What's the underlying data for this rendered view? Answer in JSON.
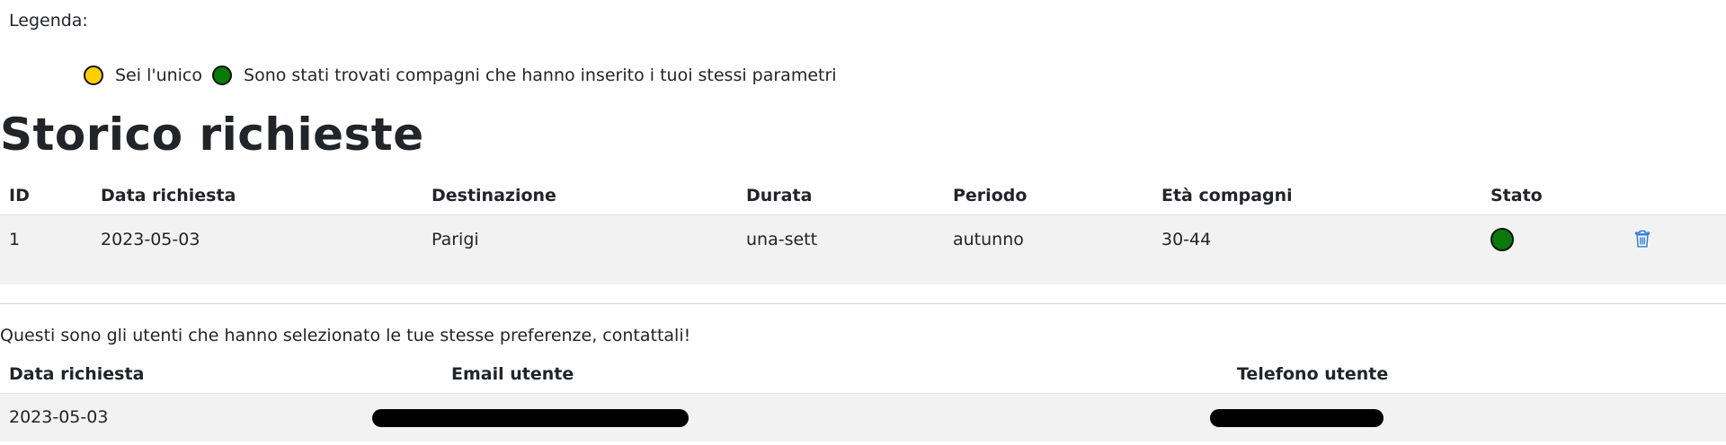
{
  "legend": {
    "title": "Legenda:",
    "items": [
      {
        "icon": "yellow-status-dot",
        "color": "#ffd000",
        "label": "Sei l'unico"
      },
      {
        "icon": "green-status-dot",
        "color": "#0a7a0a",
        "label": "Sono stati trovati compagni che hanno inserito i tuoi stessi parametri"
      }
    ]
  },
  "history": {
    "title": "Storico richieste",
    "columns": [
      "ID",
      "Data richiesta",
      "Destinazione",
      "Durata",
      "Periodo",
      "Età compagni",
      "Stato",
      ""
    ],
    "rows": [
      {
        "id": "1",
        "date": "2023-05-03",
        "destination": "Parigi",
        "duration": "una-sett",
        "period": "autunno",
        "age": "30-44",
        "status_icon": "green-status-dot",
        "action_icon": "trash-icon"
      }
    ]
  },
  "matches": {
    "note": "Questi sono gli utenti che hanno selezionato le tue stesse preferenze, contattali!",
    "columns": [
      "Data richiesta",
      "Email utente",
      "Telefono utente"
    ],
    "rows": [
      {
        "date": "2023-05-03",
        "email": "",
        "phone": ""
      }
    ]
  },
  "colors": {
    "accent": "#0d6efd",
    "row_background": "#f2f2f2"
  }
}
